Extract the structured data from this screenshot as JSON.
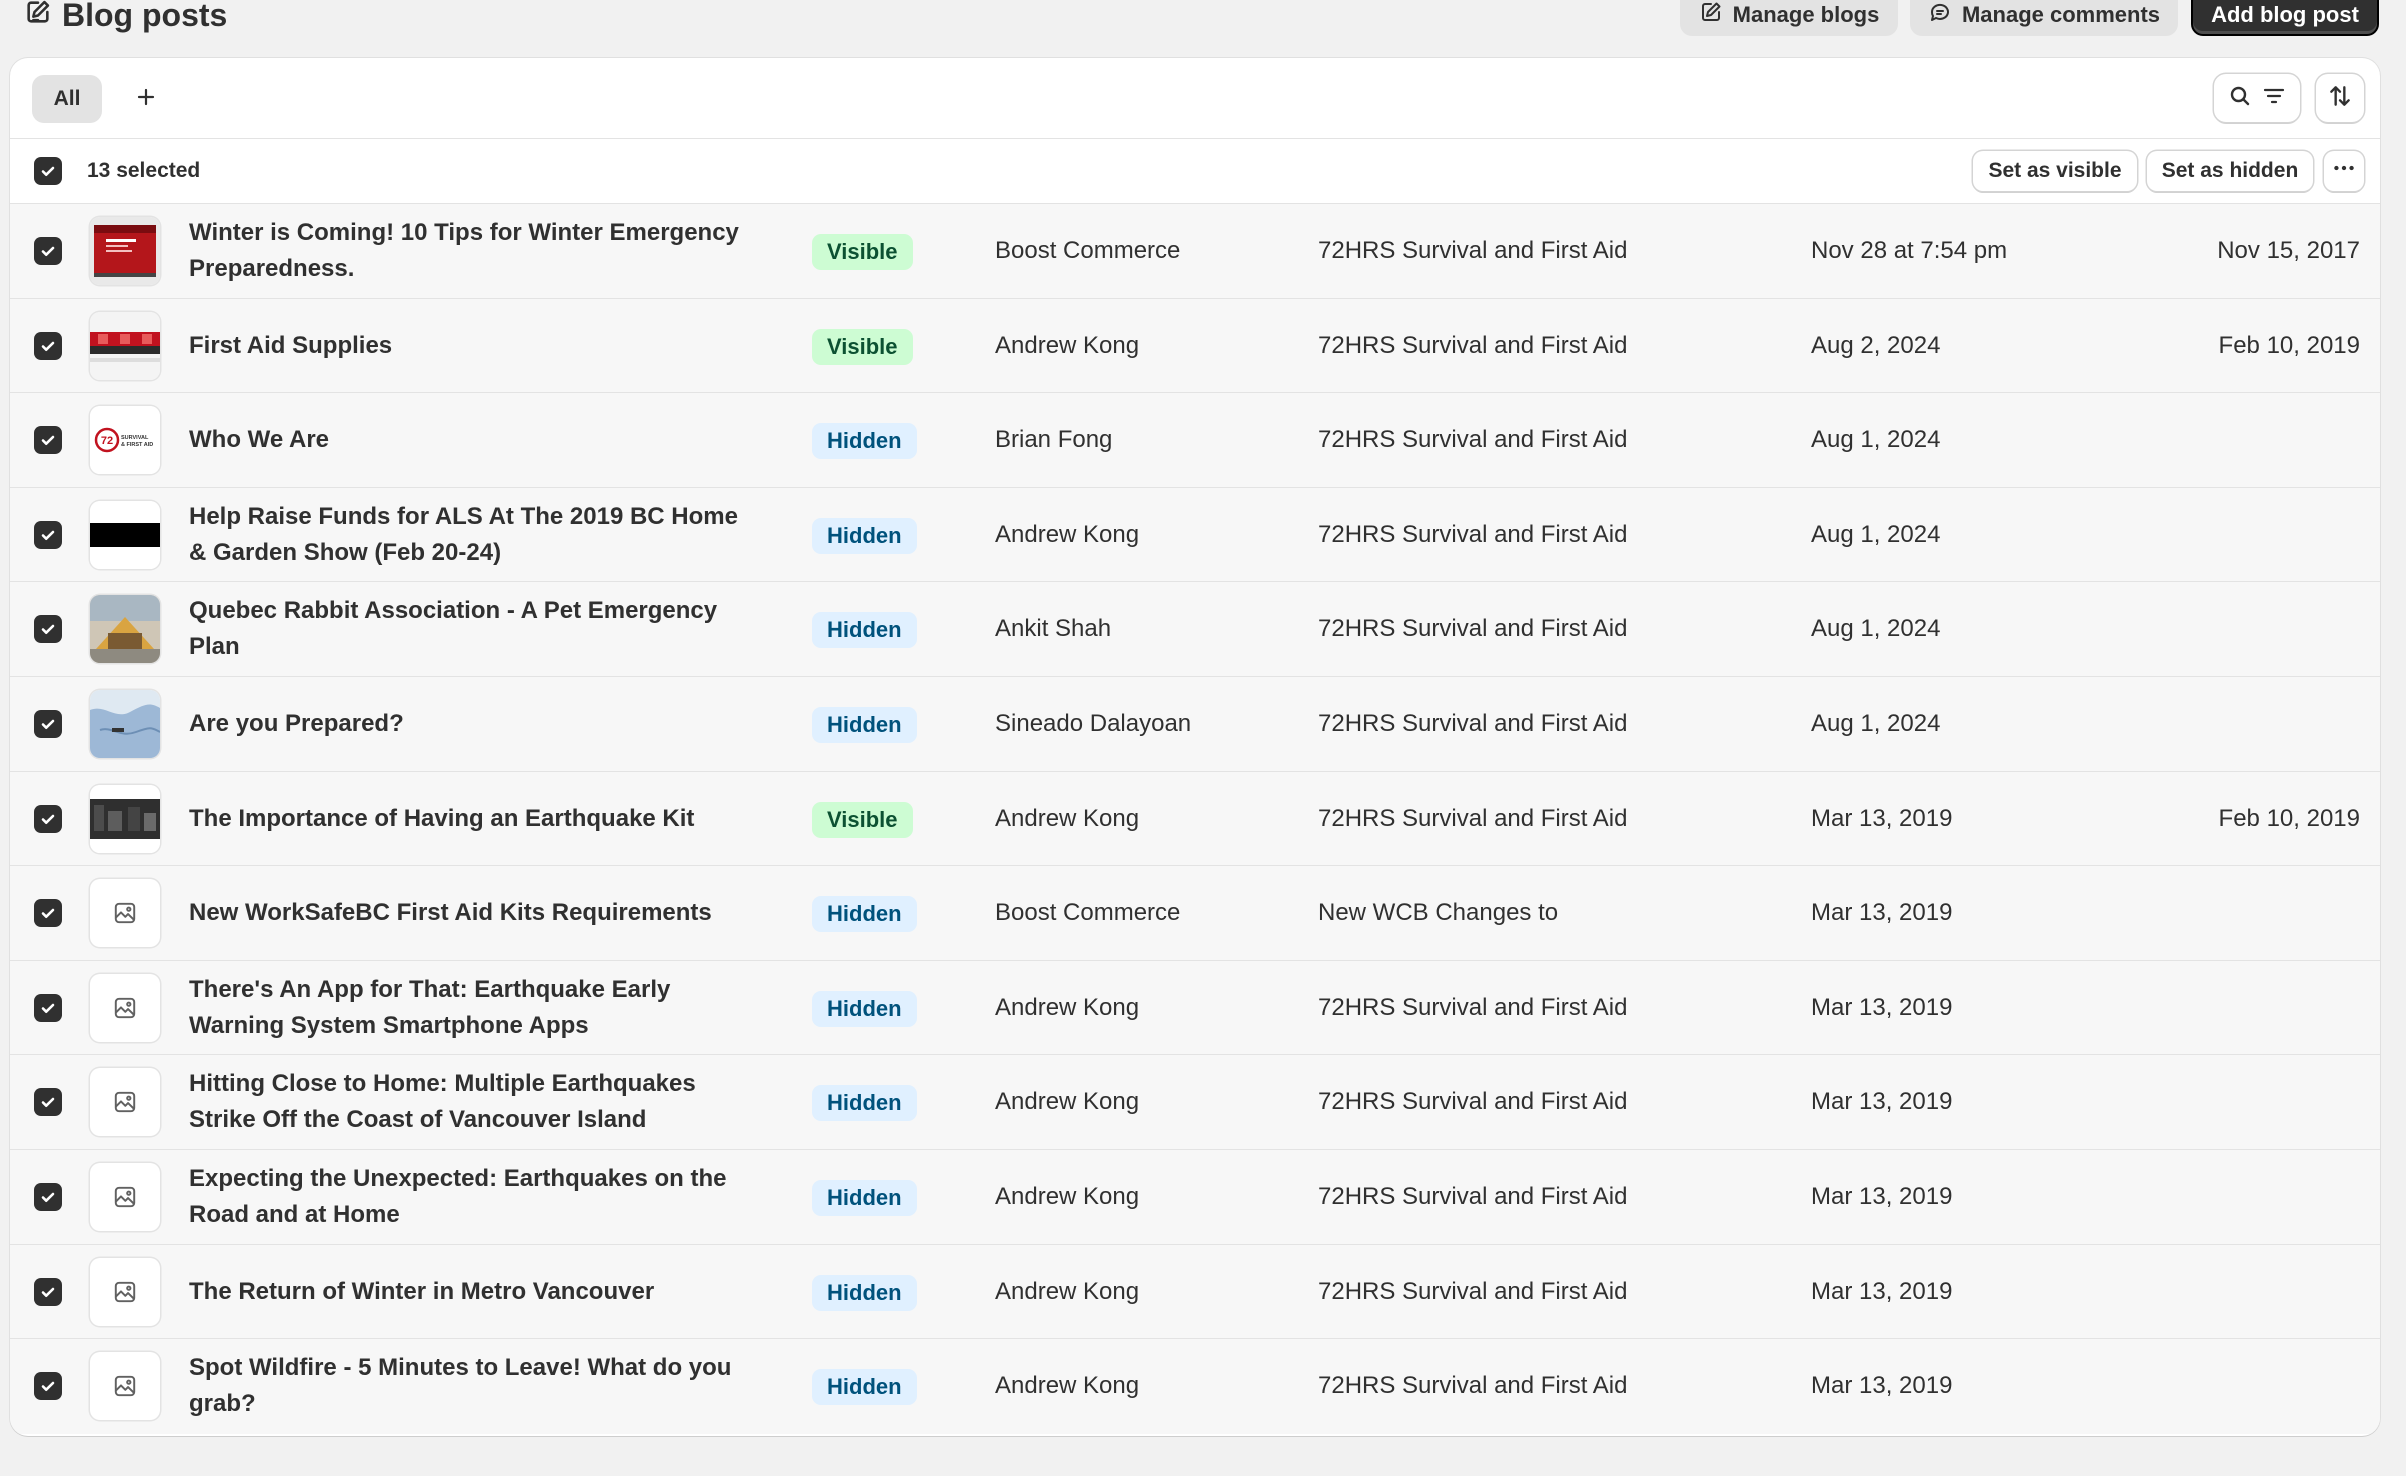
{
  "header": {
    "title": "Blog posts",
    "manage_blogs": "Manage blogs",
    "manage_comments": "Manage comments",
    "add_post": "Add blog post"
  },
  "tabs": {
    "all": "All"
  },
  "bulk": {
    "selected_label": "13 selected",
    "set_visible": "Set as visible",
    "set_hidden": "Set as hidden"
  },
  "posts": [
    {
      "title": "Winter is Coming! 10 Tips for Winter Emergency Preparedness.",
      "status": "Visible",
      "author": "Boost Commerce",
      "blog": "72HRS Survival and First Aid",
      "updated": "Nov 28 at 7:54 pm",
      "published": "Nov 15, 2017",
      "thumb": "red-banner"
    },
    {
      "title": "First Aid Supplies",
      "status": "Visible",
      "author": "Andrew Kong",
      "blog": "72HRS Survival and First Aid",
      "updated": "Aug 2, 2024",
      "published": "Feb 10, 2019",
      "thumb": "red-shelf"
    },
    {
      "title": "Who We Are",
      "status": "Hidden",
      "author": "Brian Fong",
      "blog": "72HRS Survival and First Aid",
      "updated": "Aug 1, 2024",
      "published": "",
      "thumb": "logo"
    },
    {
      "title": "Help Raise Funds for ALS At The 2019 BC Home & Garden Show (Feb 20-24)",
      "status": "Hidden",
      "author": "Andrew Kong",
      "blog": "72HRS Survival and First Aid",
      "updated": "Aug 1, 2024",
      "published": "",
      "thumb": "black-band"
    },
    {
      "title": "Quebec Rabbit Association - A Pet Emergency Plan",
      "status": "Hidden",
      "author": "Ankit Shah",
      "blog": "72HRS Survival and First Aid",
      "updated": "Aug 1, 2024",
      "published": "",
      "thumb": "rabbit"
    },
    {
      "title": "Are you Prepared?",
      "status": "Hidden",
      "author": "Sineado Dalayoan",
      "blog": "72HRS Survival and First Aid",
      "updated": "Aug 1, 2024",
      "published": "",
      "thumb": "map"
    },
    {
      "title": "The Importance of Having an Earthquake Kit",
      "status": "Visible",
      "author": "Andrew Kong",
      "blog": "72HRS Survival and First Aid",
      "updated": "Mar 13, 2019",
      "published": "Feb 10, 2019",
      "thumb": "dark-street"
    },
    {
      "title": "New WorkSafeBC First Aid Kits Requirements",
      "status": "Hidden",
      "author": "Boost Commerce",
      "blog": "New WCB Changes to",
      "updated": "Mar 13, 2019",
      "published": "",
      "thumb": "placeholder-image-icon"
    },
    {
      "title": "There's An App for That: Earthquake Early Warning System Smartphone Apps",
      "status": "Hidden",
      "author": "Andrew Kong",
      "blog": "72HRS Survival and First Aid",
      "updated": "Mar 13, 2019",
      "published": "",
      "thumb": "placeholder-image-icon"
    },
    {
      "title": "Hitting Close to Home: Multiple Earthquakes Strike Off the Coast of Vancouver Island",
      "status": "Hidden",
      "author": "Andrew Kong",
      "blog": "72HRS Survival and First Aid",
      "updated": "Mar 13, 2019",
      "published": "",
      "thumb": "placeholder-image-icon"
    },
    {
      "title": "Expecting the Unexpected: Earthquakes on the Road and at Home",
      "status": "Hidden",
      "author": "Andrew Kong",
      "blog": "72HRS Survival and First Aid",
      "updated": "Mar 13, 2019",
      "published": "",
      "thumb": "placeholder-image-icon"
    },
    {
      "title": "The Return of Winter in Metro Vancouver",
      "status": "Hidden",
      "author": "Andrew Kong",
      "blog": "72HRS Survival and First Aid",
      "updated": "Mar 13, 2019",
      "published": "",
      "thumb": "placeholder-image-icon"
    },
    {
      "title": "Spot Wildfire - 5 Minutes to Leave! What do you grab?",
      "status": "Hidden",
      "author": "Andrew Kong",
      "blog": "72HRS Survival and First Aid",
      "updated": "Mar 13, 2019",
      "published": "",
      "thumb": "placeholder-image-icon"
    }
  ],
  "thumb_logo_text": [
    "72",
    "SURVIVAL",
    "& FIRST AID"
  ],
  "colors": {
    "visible_bg": "#cdfcd3",
    "hidden_bg": "#e0f0ff",
    "primary_button": "#303030"
  }
}
